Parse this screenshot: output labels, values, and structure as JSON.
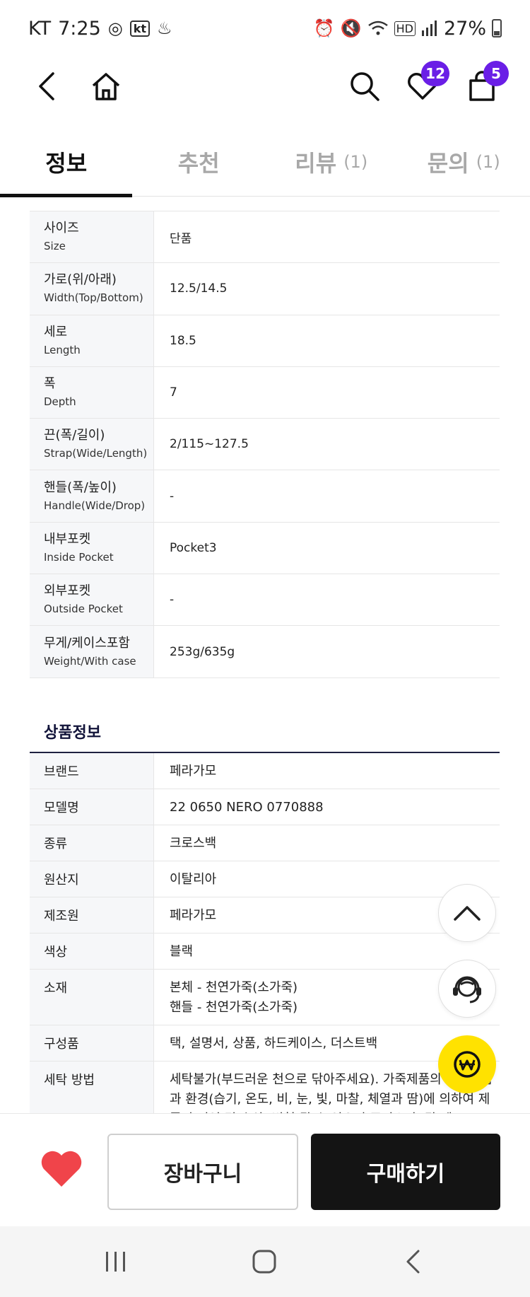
{
  "status_bar": {
    "carrier": "KT",
    "time": "7:25",
    "carrier_logo": "kt",
    "battery": "27%"
  },
  "header": {
    "wishlist_count": "12",
    "cart_count": "5"
  },
  "tabs": [
    {
      "label": "정보",
      "count": ""
    },
    {
      "label": "추천",
      "count": ""
    },
    {
      "label": "리뷰",
      "count": "(1)"
    },
    {
      "label": "문의",
      "count": "(1)"
    }
  ],
  "spec": [
    {
      "ko": "사이즈",
      "en": "Size",
      "value": "단품"
    },
    {
      "ko": "가로(위/아래)",
      "en": "Width(Top/Bottom)",
      "value": "12.5/14.5"
    },
    {
      "ko": "세로",
      "en": "Length",
      "value": "18.5"
    },
    {
      "ko": "폭",
      "en": "Depth",
      "value": "7"
    },
    {
      "ko": "끈(폭/길이)",
      "en": "Strap(Wide/Length)",
      "value": "2/115~127.5"
    },
    {
      "ko": "핸들(폭/높이)",
      "en": "Handle(Wide/Drop)",
      "value": "-"
    },
    {
      "ko": "내부포켓",
      "en": "Inside Pocket",
      "value": "Pocket3"
    },
    {
      "ko": "외부포켓",
      "en": "Outside Pocket",
      "value": "-"
    },
    {
      "ko": "무게/케이스포함",
      "en": "Weight/With case",
      "value": "253g/635g"
    }
  ],
  "product_info": {
    "title": "상품정보",
    "rows": [
      {
        "label": "브랜드",
        "value": "페라가모"
      },
      {
        "label": "모델명",
        "value": "22 0650 NERO 0770888"
      },
      {
        "label": "종류",
        "value": "크로스백"
      },
      {
        "label": "원산지",
        "value": "이탈리아"
      },
      {
        "label": "제조원",
        "value": "페라가모"
      },
      {
        "label": "색상",
        "value": "블랙"
      },
      {
        "label": "소재",
        "value": "본체 - 천연가죽(소가죽)",
        "value2": "핸들 - 천연가죽(소가죽)"
      },
      {
        "label": "구성품",
        "value": "택, 설명서, 상품, 하드케이스, 더스트백"
      },
      {
        "label": "세탁 방법",
        "value": "세탁불가(부드러운 천으로 닦아주세요). 가죽제품의 사용방법과 환경(습기, 온도, 비, 눈, 빛, 마찰, 체열과 땀)에 의하여 제품이 이염 및 손상, 변형 될 수 있으니 주의요망. 각 제"
      }
    ]
  },
  "bottom_bar": {
    "cart_label": "장바구니",
    "buy_label": "구매하기"
  },
  "colors": {
    "accent_purple": "#6a1ee6",
    "heart_red": "#f0444a",
    "pay_yellow": "#ffe200",
    "buy_black": "#141414"
  }
}
